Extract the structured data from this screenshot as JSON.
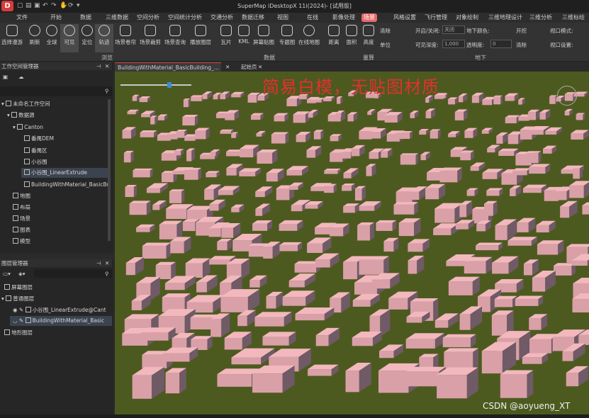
{
  "window": {
    "title": "SuperMap iDesktopX 11i(2024)- [试用版]",
    "logo_text": "D"
  },
  "menubar": {
    "items": [
      "文件",
      "开始",
      "数据",
      "三维数据",
      "空间分析",
      "空间统计分析",
      "交通分析",
      "数据迁移",
      "视图",
      "在线",
      "影像处理",
      "场景",
      "风格设置",
      "飞行管理",
      "对象绘制",
      "三维地理设计",
      "三维分析",
      "三维标绘"
    ],
    "active": "场景"
  },
  "ribbon": {
    "buttons": [
      "选择漫游",
      "刷新",
      "全球",
      "可见",
      "定位",
      "轨迹",
      "场景卷帘",
      "场景裁剪",
      "场景查询",
      "播放图层",
      "瓦片",
      "KML",
      "屏幕贴图",
      "专题图",
      "在线地图",
      "距离",
      "面积",
      "高度"
    ],
    "selected": "可见",
    "group_browse": "浏览",
    "group_data": "数据",
    "group_measure": "量算",
    "group_terrain": "地下",
    "clear_label": "清除",
    "unit_label": "单位",
    "open_close_label": "开启/关闭:",
    "open_close_value": "关闭",
    "underground_color_label": "地下颜色:",
    "visible_depth_label": "可见深度:",
    "visible_depth_value": "1,000",
    "transparency_label": "透明度:",
    "transparency_value": "0",
    "clear2_label": "清除",
    "excavate_label": "开挖",
    "viewport_mode_label": "视口模式:",
    "viewport_settings_label": "视口设置:"
  },
  "workspace_panel": {
    "title": "工作空间管理器",
    "items": [
      {
        "label": "未命名工作空间",
        "level": 0
      },
      {
        "label": "数据源",
        "level": 1
      },
      {
        "label": "Canton",
        "level": 2
      },
      {
        "label": "番禺DEM",
        "level": 3
      },
      {
        "label": "番禺区",
        "level": 3
      },
      {
        "label": "小谷围",
        "level": 3
      },
      {
        "label": "小谷围_LinearExtrude",
        "level": 3
      },
      {
        "label": "BuildingWithMaterial_BasicBu",
        "level": 3
      },
      {
        "label": "地图",
        "level": 1
      },
      {
        "label": "布局",
        "level": 1
      },
      {
        "label": "场景",
        "level": 1
      },
      {
        "label": "图表",
        "level": 1
      },
      {
        "label": "模型",
        "level": 1
      }
    ],
    "selected": "小谷围_LinearExtrude"
  },
  "layer_panel": {
    "title": "图层管理器",
    "items": [
      {
        "label": "屏幕图层",
        "level": 0
      },
      {
        "label": "普通图层",
        "level": 0
      },
      {
        "label": "小谷围_LinearExtrude@Cant",
        "level": 1
      },
      {
        "label": "BuildingWithMaterial_Basic",
        "level": 1
      },
      {
        "label": "地形图层",
        "level": 0
      }
    ],
    "selected": "BuildingWithMaterial_Basic"
  },
  "tabs": [
    {
      "label": "BuildingWithMaterial_BasicBuilding_...",
      "active": true
    },
    {
      "label": "起始页",
      "active": false
    }
  ],
  "viewport": {
    "overlay_text": "简易白模，无贴图材质",
    "ground_color": "#4d5a1f",
    "building_color": "#f2b8bd"
  },
  "watermark": "CSDN @aoyueng_XT"
}
